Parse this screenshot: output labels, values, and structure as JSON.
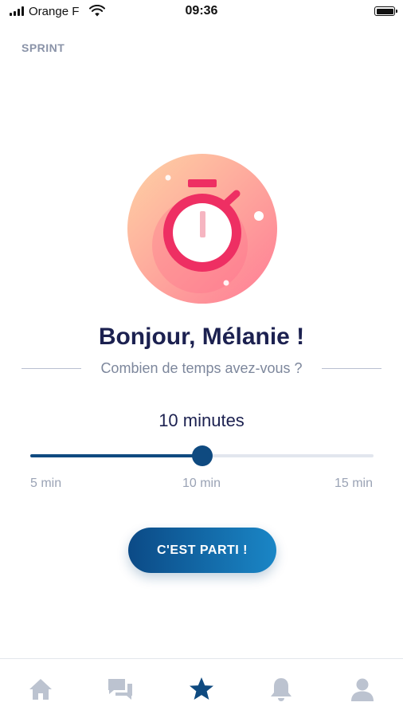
{
  "status_bar": {
    "carrier": "Orange F",
    "time": "09:36",
    "battery_level": 1.0
  },
  "header": {
    "sprint_label": "SPRINT"
  },
  "hero": {
    "icon": "stopwatch-icon",
    "colors": {
      "circle_light": "#fdd3a4",
      "circle_dark": "#ff7c95",
      "stopwatch": "#ee2f63",
      "hand": "#f6b5c1"
    }
  },
  "greeting": "Bonjour, Mélanie !",
  "question": "Combien de temps avez-vous ?",
  "duration": {
    "label": "10 minutes",
    "slider": {
      "min": 5,
      "max": 15,
      "value": 10
    },
    "ticks": {
      "min": "5 min",
      "mid": "10 min",
      "max": "15 min"
    }
  },
  "cta": {
    "label": "C'EST PARTI !"
  },
  "tab_bar": {
    "tabs": [
      {
        "icon": "home-icon",
        "active": false
      },
      {
        "icon": "chat-icon",
        "active": false
      },
      {
        "icon": "star-icon",
        "active": true
      },
      {
        "icon": "bell-icon",
        "active": false
      },
      {
        "icon": "user-icon",
        "active": false
      }
    ],
    "active_color": "#0f4a80",
    "inactive_color": "#bcc3d0"
  }
}
